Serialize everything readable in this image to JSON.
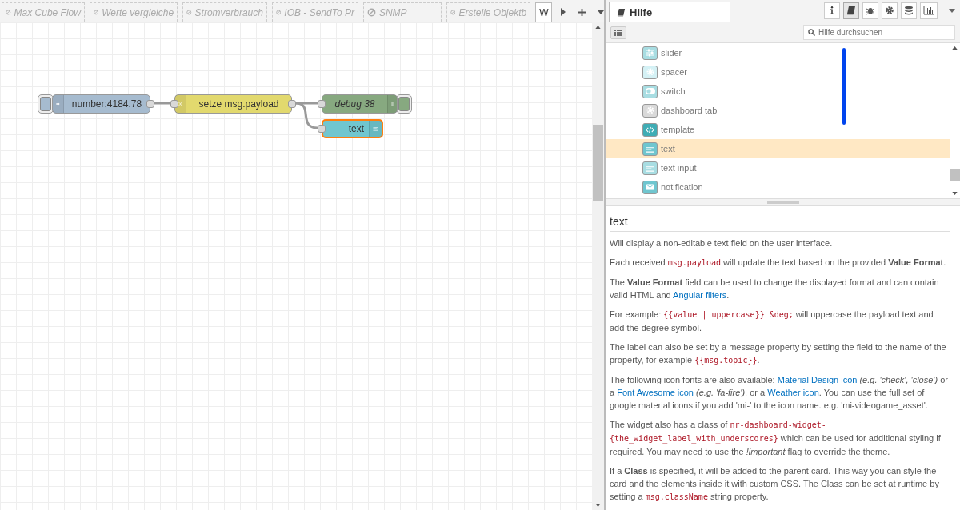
{
  "workspace_tabs": [
    {
      "label": "Max Cube Flow",
      "disabled": true,
      "selected": false
    },
    {
      "label": "Werte vergleiche",
      "disabled": true,
      "selected": false
    },
    {
      "label": "Stromverbrauch",
      "disabled": true,
      "selected": false
    },
    {
      "label": "IOB - SendTo Pr",
      "disabled": true,
      "selected": false
    },
    {
      "label": "SNMP",
      "disabled": true,
      "selected": false
    },
    {
      "label": "Erstelle Objektb",
      "disabled": true,
      "selected": false
    },
    {
      "label": "W",
      "disabled": false,
      "selected": true
    }
  ],
  "nodes": [
    {
      "kind": "inject",
      "label": "number:4184.78",
      "color": "#a6bbcf",
      "selected": false
    },
    {
      "kind": "change",
      "label": "setze msg.payload",
      "color": "#e2d96e",
      "selected": false
    },
    {
      "kind": "debug",
      "label": "debug 38",
      "color": "#87a980",
      "selected": false
    },
    {
      "kind": "text",
      "label": "text",
      "color": "#70c6cf",
      "selected": true
    }
  ],
  "sidebar": {
    "title": "Hilfe",
    "tools": [
      {
        "kind": "info",
        "selected": false
      },
      {
        "kind": "help",
        "selected": true
      },
      {
        "kind": "debug",
        "selected": false
      },
      {
        "kind": "config",
        "selected": false
      },
      {
        "kind": "context",
        "selected": false
      },
      {
        "kind": "dashboard",
        "selected": false
      }
    ],
    "search": {
      "placeholder": "Hilfe durchsuchen"
    },
    "palette": [
      {
        "kind": "slider",
        "label": "slider",
        "color": "#a8dde2",
        "selected": false
      },
      {
        "kind": "spacer",
        "label": "spacer",
        "color": "#d4f1f5",
        "selected": false
      },
      {
        "kind": "switch",
        "label": "switch",
        "color": "#a8dde2",
        "selected": false
      },
      {
        "kind": "gear",
        "label": "dashboard tab",
        "color": "#d9d9d9",
        "selected": false
      },
      {
        "kind": "template",
        "label": "template",
        "color": "#3fadb5",
        "selected": false
      },
      {
        "kind": "text",
        "label": "text",
        "color": "#70c6cf",
        "selected": true
      },
      {
        "kind": "text",
        "label": "text input",
        "color": "#a8dde2",
        "selected": false
      },
      {
        "kind": "notification",
        "label": "notification",
        "color": "#70c6cf",
        "selected": false
      }
    ]
  },
  "help": {
    "title": "text",
    "paragraphs": [
      [
        {
          "kind": "text",
          "text": "Will display a non-editable text field on the user interface."
        }
      ],
      [
        {
          "kind": "text",
          "text": "Each received "
        },
        {
          "kind": "code",
          "text": "msg.payload"
        },
        {
          "kind": "text",
          "text": " will update the text based on the provided **Value Format**."
        }
      ],
      [
        {
          "kind": "text",
          "text": "The **Value Format** field can be used to change the displayed format and can contain valid HTML and "
        },
        {
          "kind": "link",
          "text": "Angular filters"
        },
        {
          "kind": "text",
          "text": "."
        }
      ],
      [
        {
          "kind": "text",
          "text": "For example: "
        },
        {
          "kind": "code",
          "text": "{{value | uppercase}} &deg;"
        },
        {
          "kind": "text",
          "text": " will uppercase the payload text and add the degree symbol."
        }
      ],
      [
        {
          "kind": "text",
          "text": "The label can also be set by a message property by setting the field to the name of the property, for example "
        },
        {
          "kind": "code",
          "text": "{{msg.topic}}"
        },
        {
          "kind": "text",
          "text": "."
        }
      ],
      [
        {
          "kind": "text",
          "text": "The following icon fonts are also available: "
        },
        {
          "kind": "link",
          "text": "Material Design icon"
        },
        {
          "kind": "text",
          "text": " *(e.g. 'check', 'close')* or a "
        },
        {
          "kind": "link",
          "text": "Font Awesome icon"
        },
        {
          "kind": "text",
          "text": " *(e.g. 'fa-fire')*, or a "
        },
        {
          "kind": "link",
          "text": "Weather icon"
        },
        {
          "kind": "text",
          "text": ". You can use the full set of google material icons if you add 'mi-' to the icon name. e.g. 'mi-videogame_asset'."
        }
      ],
      [
        {
          "kind": "text",
          "text": "The widget also has a class of "
        },
        {
          "kind": "code",
          "text": "nr-dashboard-widget-{the_widget_label_with_underscores}"
        },
        {
          "kind": "text",
          "text": " which can be used for additional styling if required. You may need to use the *!important* flag to override the theme."
        }
      ],
      [
        {
          "kind": "text",
          "text": "If a **Class** is specified, it will be added to the parent card. This way you can style the card and the elements inside it with custom CSS. The Class can be set at runtime by setting a "
        },
        {
          "kind": "code",
          "text": "msg.className"
        },
        {
          "kind": "text",
          "text": " string property."
        }
      ]
    ]
  }
}
